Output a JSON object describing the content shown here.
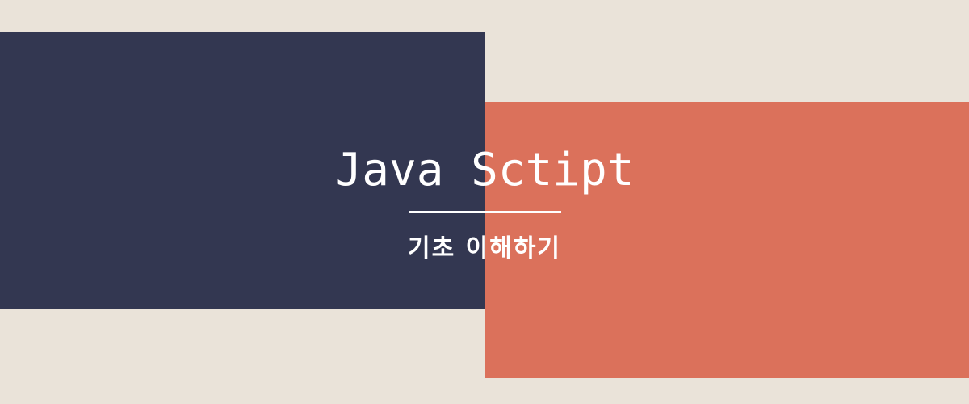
{
  "banner": {
    "title": "Java Sctipt",
    "subtitle": "기초 이해하기"
  },
  "colors": {
    "background": "#EAE3D9",
    "navy_block": "#333751",
    "coral_block": "#DB715B",
    "text": "#FFFFFF",
    "divider": "#FFFFFF"
  }
}
